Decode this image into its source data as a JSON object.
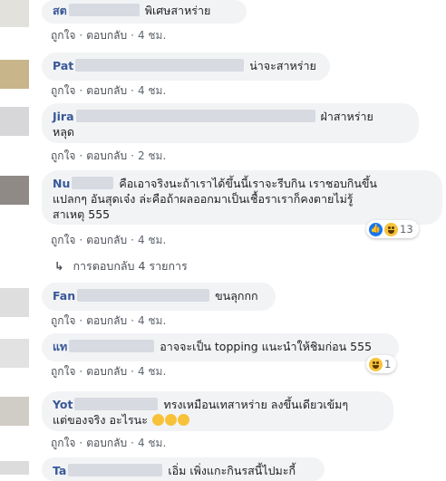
{
  "labels": {
    "like": "ถูกใจ",
    "reply": "ตอบกลับ",
    "dot": "·"
  },
  "comments": [
    {
      "name": "สต",
      "text": "พิเศษสาหร่าย",
      "time": "4 ชม."
    },
    {
      "name": "Pat",
      "text": "น่าจะสาหร่าย",
      "time": "4 ชม."
    },
    {
      "name": "Jira",
      "text_line1": "ฝ่าสาหร่าย",
      "text_line2": "หลุด",
      "time": "2 ชม."
    },
    {
      "name": "Nu",
      "text_line1": "คือเอาจริงนะถ้าเราได้ขึ้นนี้เราจะรีบกิน เราชอบกินขึ้น",
      "text_line2": "แปลกๆ อันสุดเจ๋ง ล่ะคือถ้าผลออกมาเป็นเชื้อราเราก็คงตายไม่รู้",
      "text_line3": "สาเหตุ 555",
      "time": "4 ชม.",
      "reaction_count": "13"
    },
    {
      "name": "Fan",
      "text": "ขนลุกกก",
      "time": "4 ชม."
    },
    {
      "name": "แท",
      "text": "อาจจะเป็น topping แนะนำให้ชิมก่อน 555",
      "time": "4 ชม.",
      "reaction_count": "1"
    },
    {
      "name": "Yot",
      "text_line1": "ทรงเหมือนเทสาหร่าย ลงขึ้นเดียวเข้มๆ",
      "text_line2": "แต่ของจริง อะไรนะ",
      "time": "4 ชม."
    },
    {
      "name": "Ta",
      "text": "เอิ่ม เพิ่งแกะกินรสนี้ไปมะกี้"
    }
  ],
  "replies_link": "การตอบกลับ 4 รายการ",
  "colors": {
    "bubble": "#f2f3f5",
    "name": "#385898",
    "meta": "#606770"
  },
  "icons": [
    "reply-arrow-icon",
    "like-reaction-icon",
    "haha-reaction-icon"
  ]
}
